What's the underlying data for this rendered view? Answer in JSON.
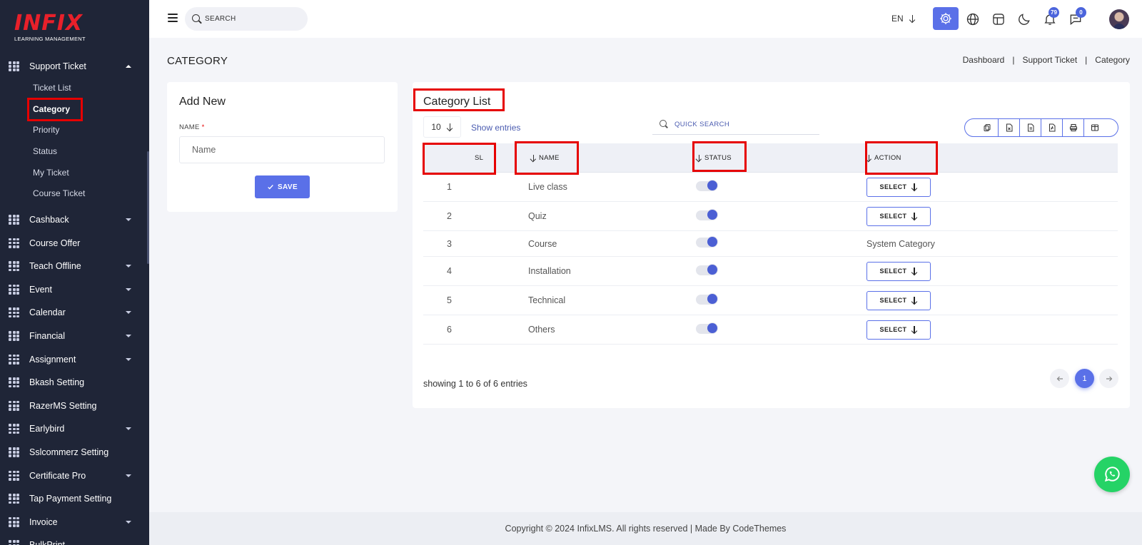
{
  "brand": {
    "name": "INFIX",
    "tagline": "LEARNING MANAGEMENT"
  },
  "sidebar": {
    "open_section": {
      "label": "Support Ticket",
      "icon": "grid-icon"
    },
    "sub_items": [
      {
        "label": "Ticket List",
        "active": false
      },
      {
        "label": "Category",
        "active": true
      },
      {
        "label": "Priority",
        "active": false
      },
      {
        "label": "Status",
        "active": false
      },
      {
        "label": "My Ticket",
        "active": false
      },
      {
        "label": "Course Ticket",
        "active": false
      }
    ],
    "items": [
      {
        "label": "Cashback",
        "has_caret": true
      },
      {
        "label": "Course Offer",
        "has_caret": false
      },
      {
        "label": "Teach Offline",
        "has_caret": true
      },
      {
        "label": "Event",
        "has_caret": true
      },
      {
        "label": "Calendar",
        "has_caret": true
      },
      {
        "label": "Financial",
        "has_caret": true
      },
      {
        "label": "Assignment",
        "has_caret": true
      },
      {
        "label": "Bkash Setting",
        "has_caret": false
      },
      {
        "label": "RazerMS Setting",
        "has_caret": false
      },
      {
        "label": "Earlybird",
        "has_caret": true
      },
      {
        "label": "Sslcommerz Setting",
        "has_caret": false
      },
      {
        "label": "Certificate Pro",
        "has_caret": true
      },
      {
        "label": "Tap Payment Setting",
        "has_caret": false
      },
      {
        "label": "Invoice",
        "has_caret": true
      },
      {
        "label": "BulkPrint",
        "has_caret": false
      }
    ]
  },
  "header": {
    "search_placeholder": "SEARCH",
    "language": "EN",
    "notifications_count": "79",
    "messages_count": "0"
  },
  "page": {
    "title": "CATEGORY",
    "breadcrumb": [
      "Dashboard",
      "Support Ticket",
      "Category"
    ]
  },
  "add_form": {
    "title": "Add New",
    "name_label": "NAME",
    "required_mark": "*",
    "name_placeholder": "Name",
    "save_label": "SAVE"
  },
  "list": {
    "title": "Category List",
    "page_size": "10",
    "show_entries_label": "Show entries",
    "quick_search_placeholder": "QUICK SEARCH",
    "columns": {
      "sl": "SL",
      "name": "NAME",
      "status": "STATUS",
      "action": "ACTION"
    },
    "rows": [
      {
        "sl": "1",
        "name": "Live class",
        "status_on": true,
        "action": "SELECT"
      },
      {
        "sl": "2",
        "name": "Quiz",
        "status_on": true,
        "action": "SELECT"
      },
      {
        "sl": "3",
        "name": "Course",
        "status_on": true,
        "action": "System Category"
      },
      {
        "sl": "4",
        "name": "Installation",
        "status_on": true,
        "action": "SELECT"
      },
      {
        "sl": "5",
        "name": "Technical",
        "status_on": true,
        "action": "SELECT"
      },
      {
        "sl": "6",
        "name": "Others",
        "status_on": true,
        "action": "SELECT"
      }
    ],
    "showing_text": "showing 1 to 6 of 6 entries",
    "current_page": "1"
  },
  "footer": {
    "text": "Copyright © 2024 InfixLMS. All rights reserved | Made By CodeThemes"
  },
  "colors": {
    "accent": "#5a70e8",
    "sidebar_bg": "#1f2537",
    "highlight": "#e60000",
    "whatsapp": "#25d366"
  }
}
